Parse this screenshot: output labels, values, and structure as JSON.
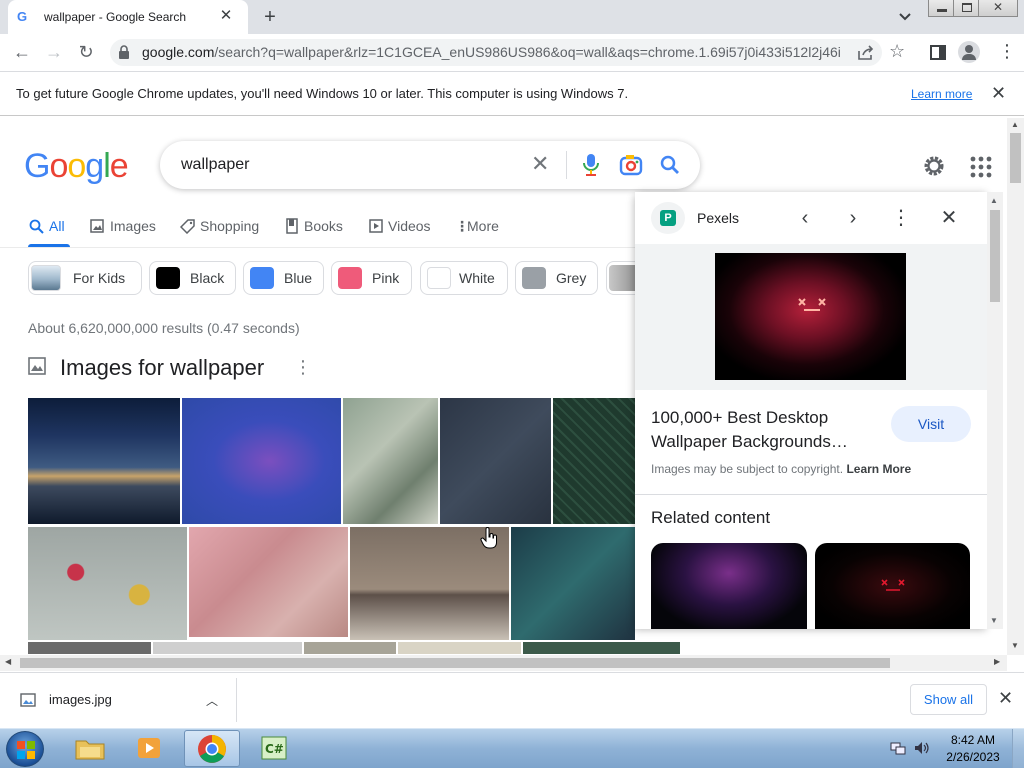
{
  "browser": {
    "tab_title": "wallpaper - Google Search",
    "url_main": "google.com",
    "url_rest": "/search?q=wallpaper&rlz=1C1GCEA_enUS986US986&oq=wall&aqs=chrome.1.69i57j0i433i512l2j46i...",
    "icons": [
      "back-icon",
      "forward-icon",
      "reload-icon",
      "lock-icon",
      "share-icon",
      "star-icon",
      "sidebar-icon",
      "profile-icon",
      "kebab-menu-icon"
    ]
  },
  "infobar": {
    "message": "To get future Google Chrome updates, you'll need Windows 10 or later. This computer is using Windows 7.",
    "learn_more": "Learn more"
  },
  "search": {
    "logo": "Google",
    "query": "wallpaper",
    "tabs": [
      {
        "label": "All",
        "active": true
      },
      {
        "label": "Images"
      },
      {
        "label": "Shopping"
      },
      {
        "label": "Books"
      },
      {
        "label": "Videos"
      },
      {
        "label": "More"
      }
    ],
    "chips": [
      {
        "label": "For Kids",
        "color": "#4a6a8a"
      },
      {
        "label": "Black",
        "color": "#000000"
      },
      {
        "label": "Blue",
        "color": "#4285f4"
      },
      {
        "label": "Pink",
        "color": "#ef5b7a"
      },
      {
        "label": "White",
        "color": "#ffffff"
      },
      {
        "label": "Grey",
        "color": "#9aa0a6"
      }
    ],
    "results_stats": "About 6,620,000,000 results (0.47 seconds)",
    "images_heading": "Images for wallpaper"
  },
  "side_panel": {
    "source": "Pexels",
    "title": "100,000+ Best Desktop Wallpaper Backgrounds…",
    "visit": "Visit",
    "copyright": "Images may be subject to copyright.",
    "copyright_link": "Learn More",
    "related": "Related content"
  },
  "downloads": {
    "file": "images.jpg",
    "show_all": "Show all"
  },
  "taskbar": {
    "time": "8:42 AM",
    "date": "2/26/2023"
  }
}
